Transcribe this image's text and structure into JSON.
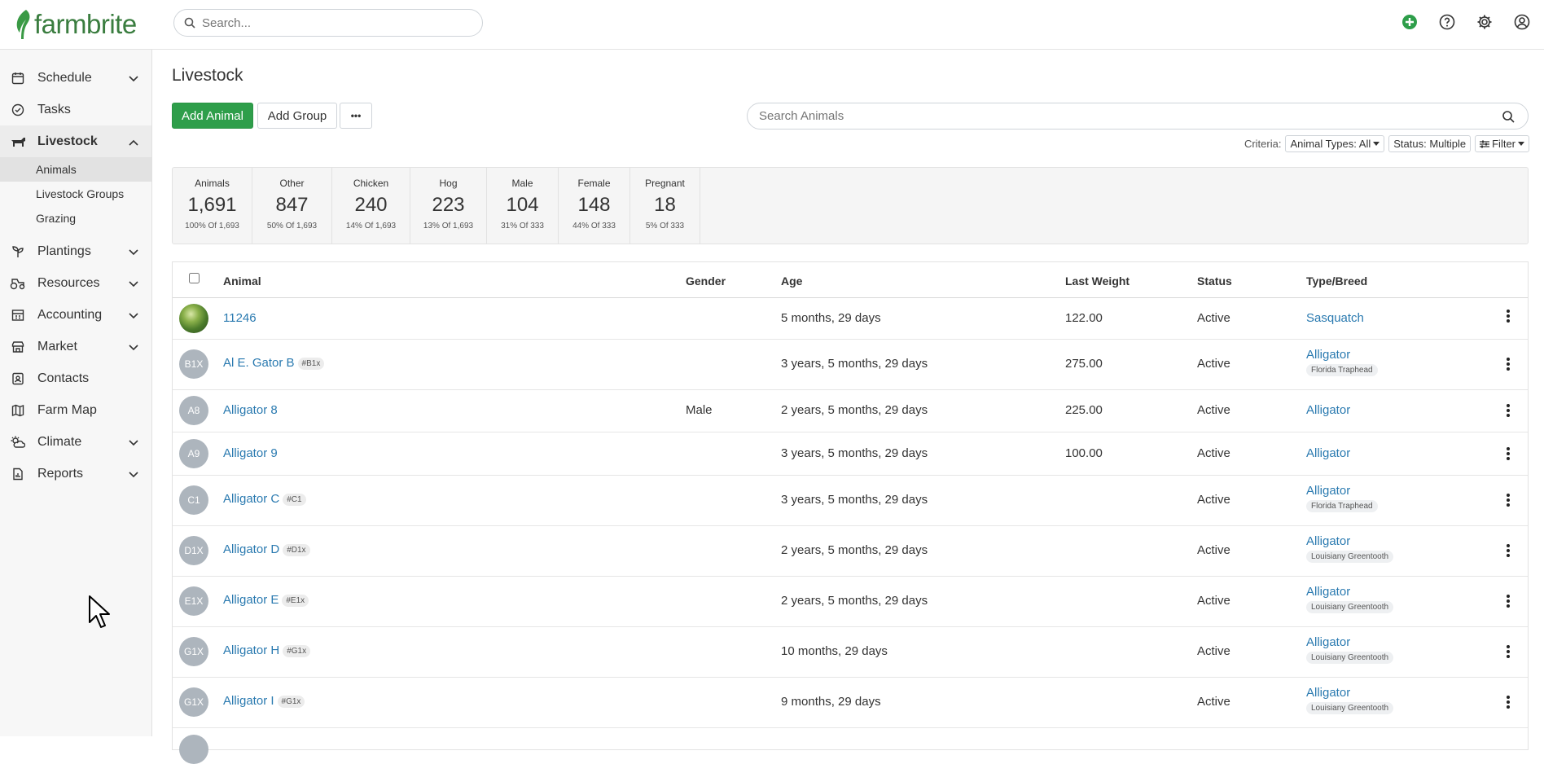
{
  "app": {
    "name": "farmbrite"
  },
  "topbar": {
    "search_placeholder": "Search..."
  },
  "sidebar": {
    "items": [
      {
        "label": "Schedule"
      },
      {
        "label": "Tasks"
      },
      {
        "label": "Livestock"
      },
      {
        "label": "Plantings"
      },
      {
        "label": "Resources"
      },
      {
        "label": "Accounting"
      },
      {
        "label": "Market"
      },
      {
        "label": "Contacts"
      },
      {
        "label": "Farm Map"
      },
      {
        "label": "Climate"
      },
      {
        "label": "Reports"
      }
    ],
    "livestock_sub": [
      {
        "label": "Animals"
      },
      {
        "label": "Livestock Groups"
      },
      {
        "label": "Grazing"
      }
    ]
  },
  "page": {
    "title": "Livestock"
  },
  "toolbar": {
    "add_animal": "Add Animal",
    "add_group": "Add Group",
    "more": "•••",
    "search_placeholder": "Search Animals"
  },
  "criteria": {
    "label": "Criteria:",
    "animal_types": "Animal Types: All",
    "status": "Status: Multiple",
    "filter": "Filter"
  },
  "stats": [
    {
      "label": "Animals",
      "value": "1,691",
      "sub": "100% Of 1,693"
    },
    {
      "label": "Other",
      "value": "847",
      "sub": "50% Of 1,693"
    },
    {
      "label": "Chicken",
      "value": "240",
      "sub": "14% Of 1,693"
    },
    {
      "label": "Hog",
      "value": "223",
      "sub": "13% Of 1,693"
    },
    {
      "label": "Male",
      "value": "104",
      "sub": "31% Of 333"
    },
    {
      "label": "Female",
      "value": "148",
      "sub": "44% Of 333"
    },
    {
      "label": "Pregnant",
      "value": "18",
      "sub": "5% Of 333"
    }
  ],
  "table": {
    "headers": {
      "animal": "Animal",
      "gender": "Gender",
      "age": "Age",
      "weight": "Last Weight",
      "status": "Status",
      "type": "Type/Breed"
    },
    "rows": [
      {
        "avatar": "",
        "name": "11246",
        "tag": "",
        "gender": "",
        "age": "5 months, 29 days",
        "weight": "122.00",
        "status": "Active",
        "type": "Sasquatch",
        "breed": ""
      },
      {
        "avatar": "B1X",
        "name": "Al E. Gator B",
        "tag": "#B1x",
        "gender": "",
        "age": "3 years, 5 months, 29 days",
        "weight": "275.00",
        "status": "Active",
        "type": "Alligator",
        "breed": "Florida Traphead"
      },
      {
        "avatar": "A8",
        "name": "Alligator 8",
        "tag": "",
        "gender": "Male",
        "age": "2 years, 5 months, 29 days",
        "weight": "225.00",
        "status": "Active",
        "type": "Alligator",
        "breed": ""
      },
      {
        "avatar": "A9",
        "name": "Alligator 9",
        "tag": "",
        "gender": "",
        "age": "3 years, 5 months, 29 days",
        "weight": "100.00",
        "status": "Active",
        "type": "Alligator",
        "breed": ""
      },
      {
        "avatar": "C1",
        "name": "Alligator C",
        "tag": "#C1",
        "gender": "",
        "age": "3 years, 5 months, 29 days",
        "weight": "",
        "status": "Active",
        "type": "Alligator",
        "breed": "Florida Traphead"
      },
      {
        "avatar": "D1X",
        "name": "Alligator D",
        "tag": "#D1x",
        "gender": "",
        "age": "2 years, 5 months, 29 days",
        "weight": "",
        "status": "Active",
        "type": "Alligator",
        "breed": "Louisiany Greentooth"
      },
      {
        "avatar": "E1X",
        "name": "Alligator E",
        "tag": "#E1x",
        "gender": "",
        "age": "2 years, 5 months, 29 days",
        "weight": "",
        "status": "Active",
        "type": "Alligator",
        "breed": "Louisiany Greentooth"
      },
      {
        "avatar": "G1X",
        "name": "Alligator H",
        "tag": "#G1x",
        "gender": "",
        "age": "10 months, 29 days",
        "weight": "",
        "status": "Active",
        "type": "Alligator",
        "breed": "Louisiany Greentooth"
      },
      {
        "avatar": "G1X",
        "name": "Alligator I",
        "tag": "#G1x",
        "gender": "",
        "age": "9 months, 29 days",
        "weight": "",
        "status": "Active",
        "type": "Alligator",
        "breed": "Louisiany Greentooth"
      }
    ]
  }
}
